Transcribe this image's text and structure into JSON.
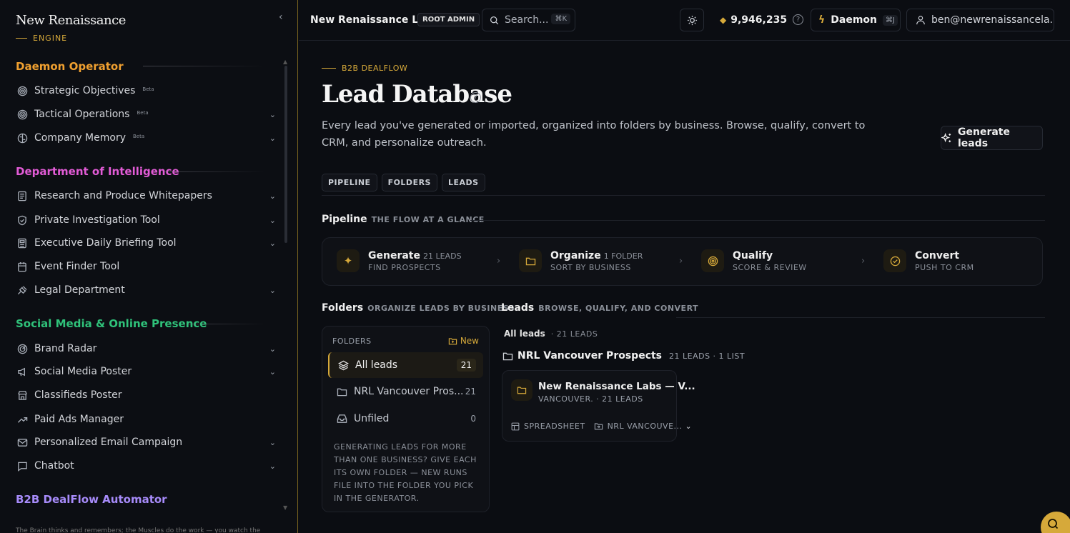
{
  "brand": {
    "title": "New Renaissance",
    "subtitle": "ENGINE"
  },
  "sidebar": {
    "sections": [
      {
        "title": "Daemon Operator",
        "color": "#f0a030",
        "items": [
          {
            "label": "Strategic Objectives",
            "icon": "target-icon",
            "beta": "Beta",
            "chevron": false
          },
          {
            "label": "Tactical Operations",
            "icon": "target-icon",
            "beta": "Beta",
            "chevron": true
          },
          {
            "label": "Company Memory",
            "icon": "brain-icon",
            "beta": "Beta",
            "chevron": true
          }
        ]
      },
      {
        "title": "Department of Intelligence",
        "color": "#e25bd6",
        "items": [
          {
            "label": "Research and Produce Whitepapers",
            "icon": "document-icon",
            "chevron": true
          },
          {
            "label": "Private Investigation Tool",
            "icon": "shield-icon",
            "chevron": true
          },
          {
            "label": "Executive Daily Briefing Tool",
            "icon": "newspaper-icon",
            "chevron": true
          },
          {
            "label": "Event Finder Tool",
            "icon": "calendar-icon",
            "chevron": false
          },
          {
            "label": "Legal Department",
            "icon": "gavel-icon",
            "chevron": true
          }
        ]
      },
      {
        "title": "Social Media & Online Presence",
        "color": "#2fc27a",
        "items": [
          {
            "label": "Brand Radar",
            "icon": "radar-icon",
            "chevron": true
          },
          {
            "label": "Social Media Poster",
            "icon": "megaphone-icon",
            "chevron": true
          },
          {
            "label": "Classifieds Poster",
            "icon": "store-icon",
            "chevron": false
          },
          {
            "label": "Paid Ads Manager",
            "icon": "trending-up-icon",
            "chevron": false
          },
          {
            "label": "Personalized Email Campaign",
            "icon": "mail-icon",
            "chevron": true
          },
          {
            "label": "Chatbot",
            "icon": "chat-icon",
            "chevron": true
          }
        ]
      },
      {
        "title": "B2B DealFlow Automator",
        "color": "#a78bfa",
        "items": []
      }
    ],
    "footer": "The Brain thinks and remembers; the Muscles do the work — you watch the"
  },
  "topbar": {
    "org": "New Renaissance Labs",
    "role": "ROOT ADMIN",
    "search_placeholder": "Search...",
    "search_kbd": "⌘K",
    "credits": "9,946,235",
    "daemon_label": "Daemon",
    "daemon_kbd": "⌘J",
    "user": "ben@newrenaissancela..."
  },
  "page": {
    "eyebrow": "B2B DEALFLOW",
    "title": "Lead Database",
    "description": "Every lead you've generated or imported, organized into folders by business. Browse, qualify, convert to CRM, and personalize outreach.",
    "generate_button": "Generate leads",
    "tabs": [
      "PIPELINE",
      "FOLDERS",
      "LEADS"
    ]
  },
  "pipeline": {
    "title": "Pipeline",
    "subtitle": "THE FLOW AT A GLANCE",
    "steps": [
      {
        "name": "Generate",
        "count": "21 LEADS",
        "sub": "FIND PROSPECTS",
        "icon": "sparkles-icon"
      },
      {
        "name": "Organize",
        "count": "1 FOLDER",
        "sub": "SORT BY BUSINESS",
        "icon": "folder-icon"
      },
      {
        "name": "Qualify",
        "count": "",
        "sub": "SCORE & REVIEW",
        "icon": "target-icon"
      },
      {
        "name": "Convert",
        "count": "",
        "sub": "PUSH TO CRM",
        "icon": "check-circle-icon"
      }
    ]
  },
  "folders": {
    "title": "Folders",
    "subtitle": "ORGANIZE LEADS BY BUSINESS",
    "panel_head": "FOLDERS",
    "new_label": "New",
    "rows": [
      {
        "label": "All leads",
        "count": "21",
        "icon": "layers-icon",
        "active": true
      },
      {
        "label": "NRL Vancouver Pros...",
        "count": "21",
        "icon": "folder-icon",
        "active": false
      },
      {
        "label": "Unfiled",
        "count": "0",
        "icon": "inbox-icon",
        "active": false
      }
    ],
    "note": "GENERATING LEADS FOR MORE THAN ONE BUSINESS? GIVE EACH ITS OWN FOLDER — NEW RUNS FILE INTO THE FOLDER YOU PICK IN THE GENERATOR."
  },
  "leads": {
    "title": "Leads",
    "subtitle": "BROWSE, QUALIFY, AND CONVERT",
    "scope": "All leads",
    "scope_count": "· 21 LEADS",
    "folder_name": "NRL Vancouver Prospects",
    "folder_meta": "21 LEADS · 1 LIST",
    "card": {
      "name": "New Renaissance Labs — V...",
      "sub": "VANCOUVER. · 21 LEADS",
      "source": "SPREADSHEET",
      "list": "NRL VANCOUVE..."
    }
  },
  "colors": {
    "accent": "#d6a93a",
    "background": "#0b0d12",
    "border": "#1e2129"
  }
}
